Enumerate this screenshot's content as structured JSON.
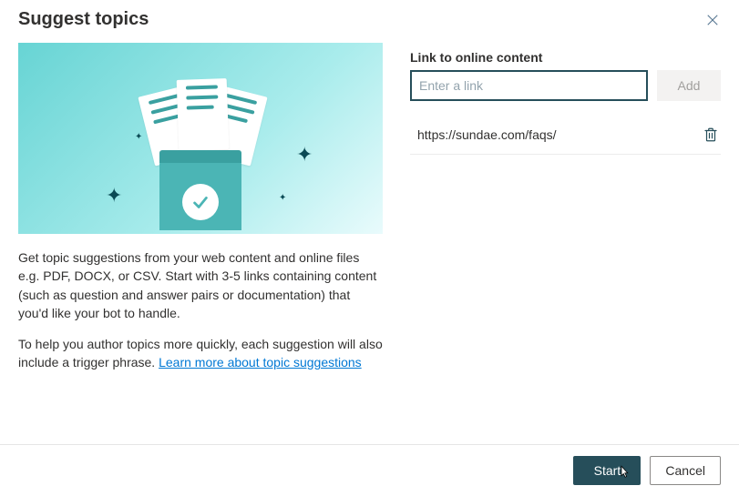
{
  "header": {
    "title": "Suggest topics"
  },
  "left": {
    "paragraph1": "Get topic suggestions from your web content and online files e.g. PDF, DOCX, or CSV. Start with 3-5 links containing content (such as question and answer pairs or documentation) that you'd like your bot to handle.",
    "paragraph2_a": "To help you author topics more quickly, each suggestion will also include a trigger phrase. ",
    "learn_link": "Learn more about topic suggestions"
  },
  "right": {
    "label": "Link to online content",
    "placeholder": "Enter a link",
    "add_label": "Add",
    "links": [
      {
        "url": "https://sundae.com/faqs/"
      }
    ]
  },
  "footer": {
    "start_label": "Start",
    "cancel_label": "Cancel"
  }
}
